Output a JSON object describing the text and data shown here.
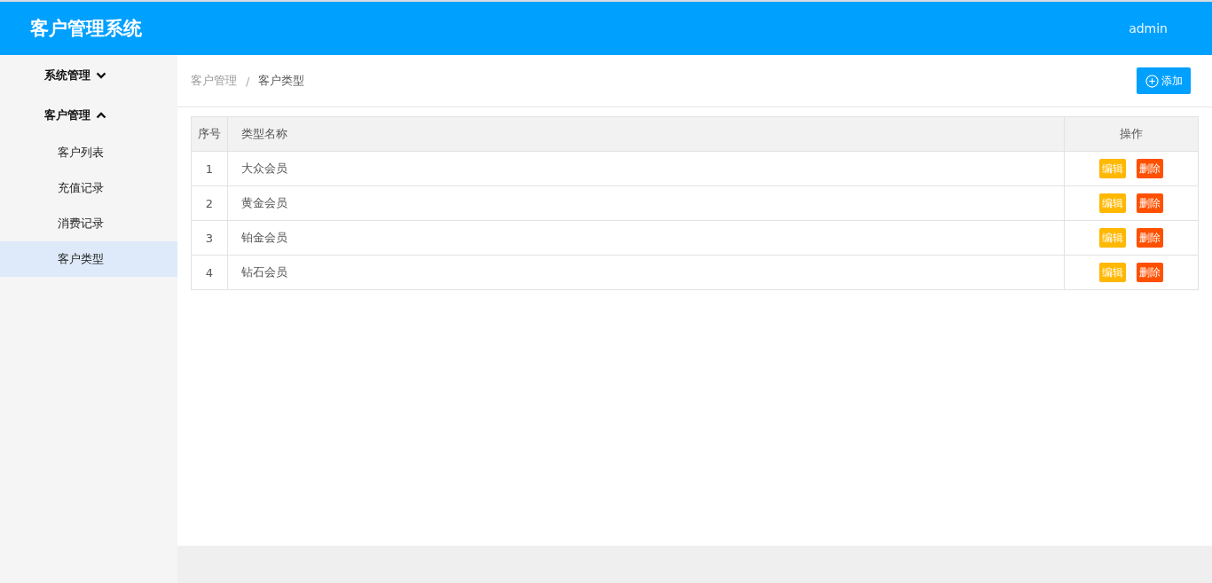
{
  "header": {
    "title": "客户管理系统",
    "user": "admin"
  },
  "sidebar": {
    "groups": [
      {
        "label": "系统管理",
        "expanded": false
      },
      {
        "label": "客户管理",
        "expanded": true,
        "children": [
          {
            "label": "客户列表",
            "selected": false
          },
          {
            "label": "充值记录",
            "selected": false
          },
          {
            "label": "消费记录",
            "selected": false
          },
          {
            "label": "客户类型",
            "selected": true
          }
        ]
      }
    ]
  },
  "breadcrumb": {
    "items": [
      "客户管理",
      "客户类型"
    ],
    "separator": "/"
  },
  "add_button": {
    "label": "添加"
  },
  "table": {
    "columns": [
      "序号",
      "类型名称",
      "操作"
    ],
    "rows": [
      {
        "index": "1",
        "name": "大众会员",
        "actions": [
          {
            "kind": "edit",
            "label": "编辑"
          },
          {
            "kind": "delete",
            "label": "删除"
          }
        ]
      },
      {
        "index": "2",
        "name": "黄金会员",
        "actions": [
          {
            "kind": "edit",
            "label": "编辑"
          },
          {
            "kind": "delete",
            "label": "删除"
          }
        ]
      },
      {
        "index": "3",
        "name": "铂金会员",
        "actions": [
          {
            "kind": "edit",
            "label": "编辑"
          },
          {
            "kind": "delete",
            "label": "删除"
          }
        ]
      },
      {
        "index": "4",
        "name": "钻石会员",
        "actions": [
          {
            "kind": "edit",
            "label": "编辑"
          },
          {
            "kind": "delete",
            "label": "删除"
          }
        ]
      }
    ]
  }
}
